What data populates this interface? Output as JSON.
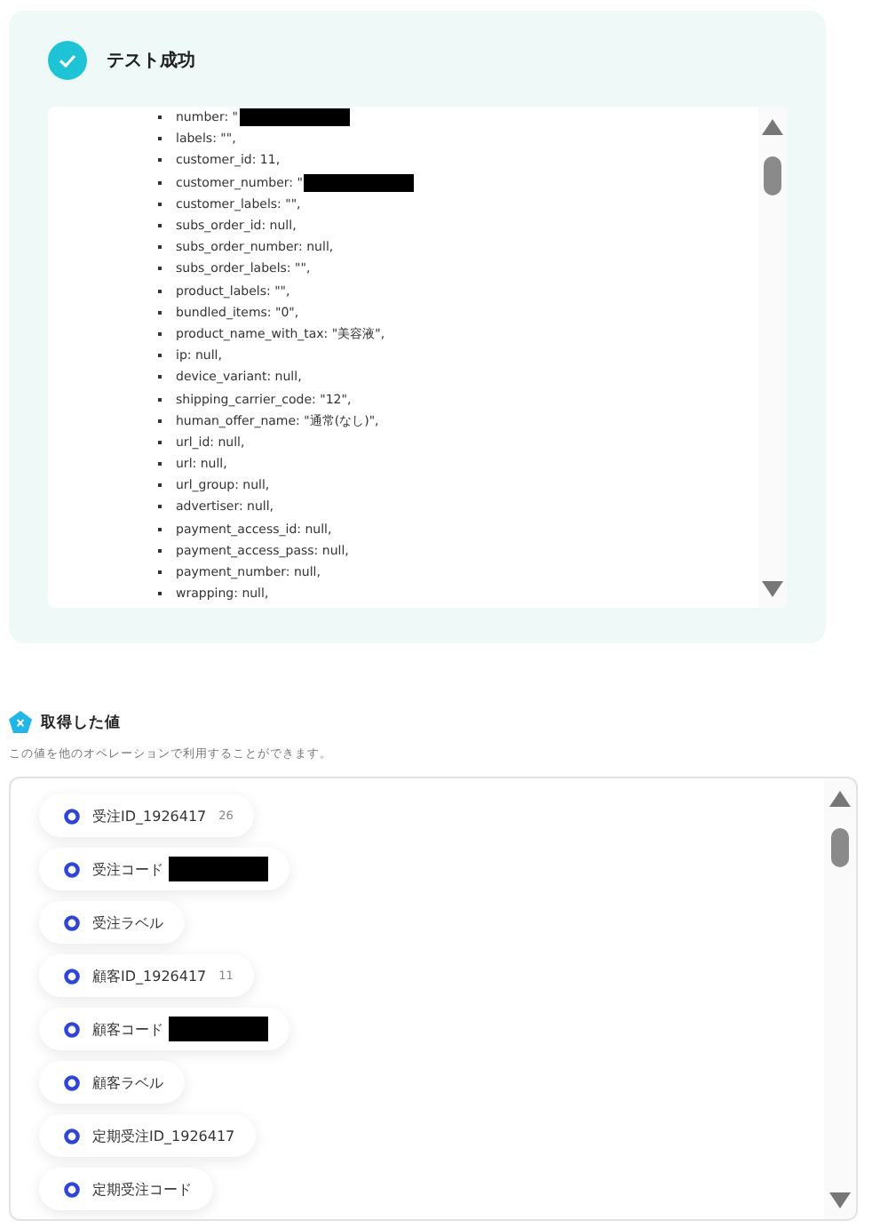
{
  "result": {
    "title": "テスト成功",
    "lines": [
      {
        "text": "number: \"",
        "redacted": true
      },
      {
        "text": "labels: \"\",",
        "redacted": false
      },
      {
        "text": "customer_id: 11,",
        "redacted": false
      },
      {
        "text": "customer_number: \"",
        "redacted": true
      },
      {
        "text": "customer_labels: \"\",",
        "redacted": false
      },
      {
        "text": "subs_order_id: null,",
        "redacted": false
      },
      {
        "text": "subs_order_number: null,",
        "redacted": false
      },
      {
        "text": "subs_order_labels: \"\",",
        "redacted": false
      },
      {
        "text": "product_labels: \"\",",
        "redacted": false
      },
      {
        "text": "bundled_items: \"0\",",
        "redacted": false
      },
      {
        "text": "product_name_with_tax: \"美容液\",",
        "redacted": false
      },
      {
        "text": "ip: null,",
        "redacted": false
      },
      {
        "text": "device_variant: null,",
        "redacted": false
      },
      {
        "text": "shipping_carrier_code: \"12\",",
        "redacted": false
      },
      {
        "text": "human_offer_name: \"通常(なし)\",",
        "redacted": false
      },
      {
        "text": "url_id: null,",
        "redacted": false
      },
      {
        "text": "url: null,",
        "redacted": false
      },
      {
        "text": "url_group: null,",
        "redacted": false
      },
      {
        "text": "advertiser: null,",
        "redacted": false
      },
      {
        "text": "payment_access_id: null,",
        "redacted": false
      },
      {
        "text": "payment_access_pass: null,",
        "redacted": false
      },
      {
        "text": "payment_number: null,",
        "redacted": false
      },
      {
        "text": "wrapping: null,",
        "redacted": false
      }
    ]
  },
  "values": {
    "title": "取得した値",
    "description": "この値を他のオペレーションで利用することができます。",
    "items": [
      {
        "label": "受注ID_1926417",
        "sample": "26",
        "redacted": false
      },
      {
        "label": "受注コード",
        "redacted": true
      },
      {
        "label": "受注ラベル",
        "redacted": false
      },
      {
        "label": "顧客ID_1926417",
        "sample": "11",
        "redacted": false
      },
      {
        "label": "顧客コード",
        "redacted": true
      },
      {
        "label": "顧客ラベル",
        "redacted": false
      },
      {
        "label": "定期受注ID_1926417",
        "redacted": false
      },
      {
        "label": "定期受注コード",
        "redacted": false
      }
    ]
  }
}
